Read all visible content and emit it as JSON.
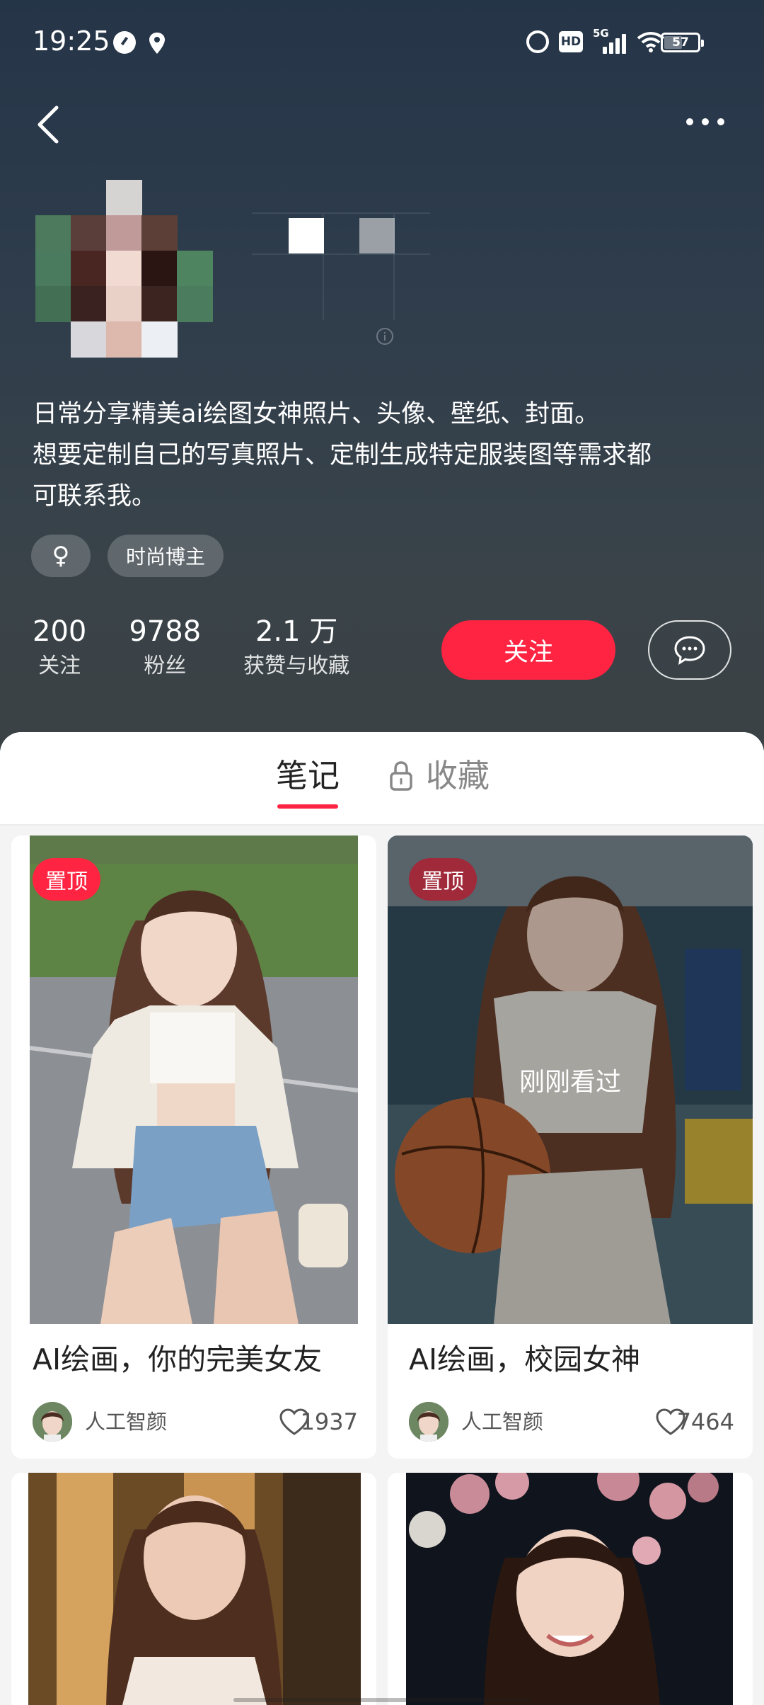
{
  "status_bar": {
    "time": "19:25",
    "network": "5G",
    "hd": "HD",
    "battery": "57",
    "battery_level": 0.57
  },
  "profile": {
    "bio_lines": [
      "日常分享精美ai绘图女神照片、头像、壁纸、封面。",
      "想要定制自己的写真照片、定制生成特定服装图等需求都",
      "可联系我。"
    ],
    "tags": [
      "♀",
      "时尚博主"
    ],
    "stats": [
      {
        "value": "200",
        "label": "关注"
      },
      {
        "value": "9788",
        "label": "粉丝"
      },
      {
        "value": "2.1 万",
        "label": "获赞与收藏"
      }
    ],
    "follow_label": "关注"
  },
  "tabs": {
    "notes": "笔记",
    "collections": "收藏"
  },
  "notes": [
    {
      "pinned": "置顶",
      "title": "AI绘画，你的完美女友",
      "author": "人工智颜",
      "likes": "1937"
    },
    {
      "pinned": "置顶",
      "title": "AI绘画，校园女神",
      "author": "人工智颜",
      "likes": "7464",
      "overlay": "刚刚看过"
    }
  ],
  "colors": {
    "accent": "#ff2442",
    "header_top": "#253548",
    "header_bottom": "#3b4245"
  }
}
